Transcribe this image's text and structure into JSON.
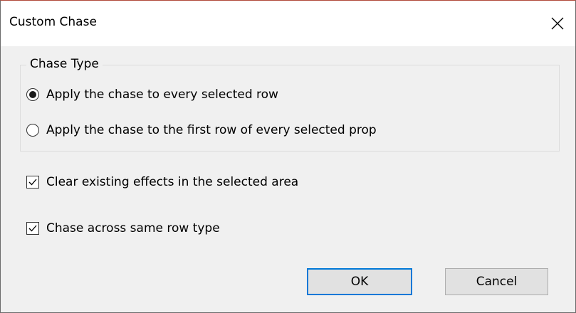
{
  "window": {
    "title": "Custom Chase"
  },
  "chase_type": {
    "legend": "Chase Type",
    "options": [
      {
        "label": "Apply the chase to every selected row",
        "selected": true
      },
      {
        "label": "Apply the chase to the first row of every selected prop",
        "selected": false
      }
    ]
  },
  "checkboxes": [
    {
      "label": "Clear existing effects in the selected area",
      "checked": true
    },
    {
      "label": "Chase across same row type",
      "checked": true
    }
  ],
  "buttons": {
    "ok": "OK",
    "cancel": "Cancel"
  },
  "icons": {
    "close": "close-icon",
    "check": "checkmark-icon"
  },
  "colors": {
    "accent": "#0078d7",
    "dialog_bg": "#f0f0f0",
    "button_bg": "#e1e1e1"
  }
}
